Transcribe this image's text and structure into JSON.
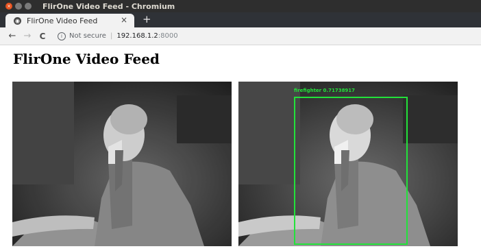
{
  "window": {
    "title": "FlirOne Video Feed - Chromium"
  },
  "tab": {
    "label": "FlirOne Video Feed",
    "close_glyph": "×",
    "new_tab_glyph": "+"
  },
  "toolbar": {
    "back_glyph": "←",
    "forward_glyph": "→",
    "reload_glyph": "C",
    "security_text": "Not secure",
    "url_host": "192.168.1.2",
    "url_port": ":8000"
  },
  "page": {
    "heading": "FlirOne Video Feed"
  },
  "detection": {
    "label": "firefighter 0.71738917",
    "color": "#22e23a"
  }
}
